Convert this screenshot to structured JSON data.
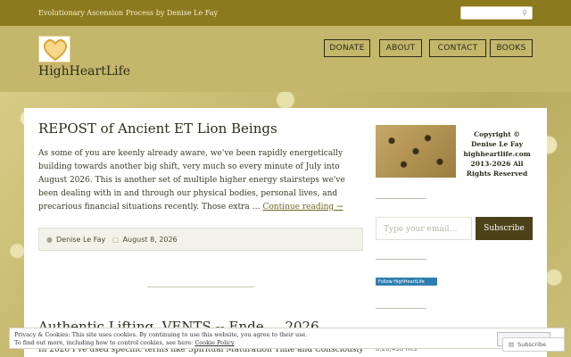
{
  "topbar": {
    "tagline": "Evolutionary Ascension Process by Denise Le Fay",
    "search_icon": "🔍"
  },
  "site": {
    "title": "HighHeartLife",
    "logo_icon": "heart-logo"
  },
  "nav": {
    "items": [
      "DONATE",
      "ABOUT",
      "CONTACT",
      "BOOKS"
    ]
  },
  "post": {
    "title": "REPOST of Ancient ET Lion Beings",
    "excerpt": "As some of you are keenly already aware, we've been rapidly energetically building towards another big shift, very much so every minute of July into August 2026. This is another set of multiple higher energy stairsteps we've been dealing with in and through our physical bodies, personal lives, and precarious financial situations recently. Those extra …",
    "continue_label": "Continue reading →",
    "author": "Denise Le Fay",
    "date": "August 8, 2026",
    "author_icon": "user-icon",
    "date_icon": "calendar-icon"
  },
  "post2": {
    "title": "Authentic Lifting, VENTS -- Ende ... 2026",
    "excerpt": "In 2026 I've used specific terms like Spiritual Maturation Time and Consciously"
  },
  "sidebar": {
    "copyright": "Copyright © Denise Le Fay highheartlife.com 2013-2026 All Rights Reserved",
    "email_placeholder": "Type your email…",
    "subscribe_label": "Subscribe",
    "follow_label": "Follow HighHeartLife",
    "counter": "8,26,496 hits"
  },
  "cookie": {
    "line1": "Privacy & Cookies: This site uses cookies. By continuing to use this website, you agree to their use.",
    "line2_prefix": "To find out more, including how to control cookies, see here: ",
    "link": "Cookie Policy",
    "close_label": "Close and accept"
  },
  "floating": {
    "subscribe_label": "Subscribe"
  },
  "colors": {
    "topbar": "#8c7a1f",
    "header": "#c4b66a",
    "subscribe_button": "#4a4219",
    "follow_badge": "#2f7fb1"
  }
}
